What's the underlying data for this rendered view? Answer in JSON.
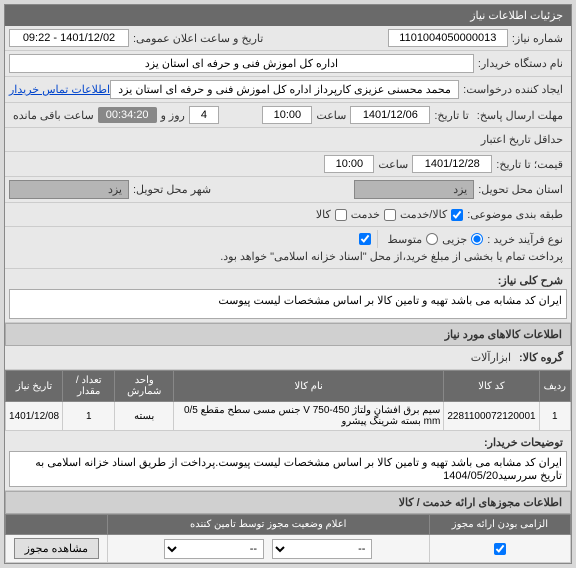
{
  "header": {
    "title": "جزئیات اطلاعات نیاز"
  },
  "info": {
    "need_no_lbl": "شماره نیاز:",
    "need_no": "1101004050000013",
    "pub_date_lbl": "تاریخ و ساعت اعلان عمومی:",
    "pub_date": "1401/12/02 - 09:22",
    "buyer_org_lbl": "نام دستگاه خریدار:",
    "buyer_org": "اداره کل اموزش فنی و حرفه ای استان یزد",
    "requester_lbl": "ایجاد کننده درخواست:",
    "requester": "محمد محسنی عزیزی کارپرداز اداره کل اموزش فنی و حرفه ای استان یزد",
    "contact_link": "اطلاعات تماس خریدار",
    "resp_deadline_lbl": "مهلت ارسال پاسخ:",
    "resp_deadline_unit": "تا تاریخ:",
    "resp_date": "1401/12/06",
    "time_lbl": "ساعت",
    "resp_time": "10:00",
    "day_lbl": "روز و",
    "days": "4",
    "remain_lbl": "ساعت باقی مانده",
    "remain": "00:34:20",
    "min_valid_lbl": "حداقل تاریخ اعتبار",
    "price_until_lbl": "قیمت؛ تا تاریخ:",
    "valid_date": "1401/12/28",
    "valid_time": "10:00",
    "delivery_state_lbl": "استان محل تحویل:",
    "delivery_state": "یزد",
    "delivery_city_lbl": "شهر محل تحویل:",
    "delivery_city": "یزد",
    "class_lbl": "طبقه بندی موضوعی:",
    "class_goods": "کالا/خدمت",
    "class_service": "خدمت",
    "class_goods_only": "کالا",
    "process_lbl": "نوع فرآیند خرید :",
    "proc_partial": "جزیی",
    "proc_medium": "متوسط",
    "payment_note": "پرداخت تمام یا بخشی از مبلغ خرید،از محل \"اسناد خزانه اسلامی\" خواهد بود."
  },
  "desc": {
    "title_lbl": "شرح کلی نیاز:",
    "title": "ایران کد مشابه می باشد تهیه و تامین کالا بر اساس مشخصات لیست پیوست"
  },
  "goods": {
    "section": "اطلاعات کالاهای مورد نیاز",
    "group_lbl": "گروه کالا:",
    "group": "ابزارآلات",
    "cols": {
      "row": "ردیف",
      "code": "کد کالا",
      "name": "نام کالا",
      "unit": "واحد شمارش",
      "qty": "تعداد / مقدار",
      "date": "تاریخ نیاز"
    },
    "rows": [
      {
        "row": "1",
        "code": "2281100072120001",
        "name": "سیم برق افشان ولتاژ 450-750 V جنس مسی سطح مقطع 0/5 mm بسته شرینگ پیشرو",
        "unit": "بسته",
        "qty": "1",
        "date": "1401/12/08"
      }
    ],
    "buyer_notes_lbl": "توضیحات خریدار:",
    "buyer_notes": "ایران کد مشابه می باشد تهیه و تامین کالا بر اساس مشخصات لیست پیوست.پرداخت از طریق اسناد خزانه اسلامی به تاریخ سررسید1404/05/20"
  },
  "permits": {
    "section": "اطلاعات مجوزهای ارائه خدمت / کالا",
    "col1": "الزامی بودن ارائه مجوز",
    "col2": "اعلام وضعیت مجوز توسط تامین کننده",
    "view_btn": "مشاهده مجوز",
    "dash": "--"
  }
}
